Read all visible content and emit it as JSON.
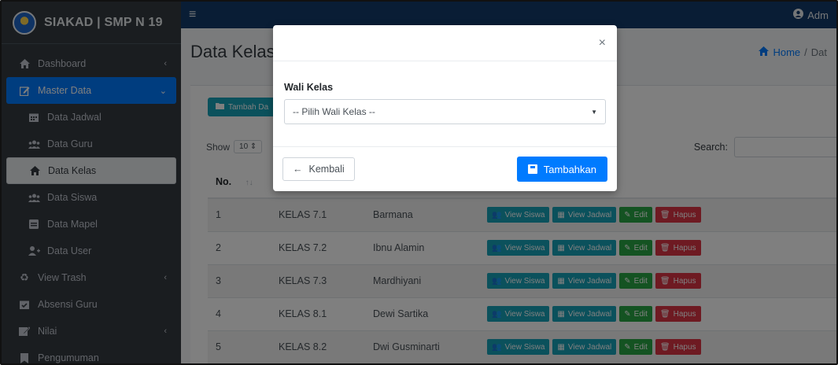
{
  "brand": {
    "title": "SIAKAD | SMP N 19"
  },
  "topbar": {
    "user": "Adm"
  },
  "sidebar": {
    "items": [
      {
        "label": "Dashboard",
        "icon": "home-icon"
      },
      {
        "label": "Master Data",
        "icon": "edit-icon"
      },
      {
        "label": "Data Jadwal",
        "icon": "calendar-icon"
      },
      {
        "label": "Data Guru",
        "icon": "users-icon"
      },
      {
        "label": "Data Kelas",
        "icon": "home-icon"
      },
      {
        "label": "Data Siswa",
        "icon": "users-icon"
      },
      {
        "label": "Data Mapel",
        "icon": "book-icon"
      },
      {
        "label": "Data User",
        "icon": "user-plus-icon"
      },
      {
        "label": "View Trash",
        "icon": "recycle-icon"
      },
      {
        "label": "Absensi Guru",
        "icon": "calendar-check-icon"
      },
      {
        "label": "Nilai",
        "icon": "clipboard-icon"
      },
      {
        "label": "Pengumuman",
        "icon": "bookmark-icon"
      }
    ]
  },
  "page": {
    "title": "Data Kelas",
    "breadcrumb_home": "Home",
    "breadcrumb_current": "Dat"
  },
  "toolbar": {
    "add_label": "Tambah Da",
    "show_label": "Show",
    "show_value": "10",
    "search_label": "Search:"
  },
  "table": {
    "headers": {
      "no": "No."
    },
    "rows": [
      {
        "no": "1",
        "kelas": "KELAS 7.1",
        "wali": "Barmana"
      },
      {
        "no": "2",
        "kelas": "KELAS 7.2",
        "wali": "Ibnu Alamin"
      },
      {
        "no": "3",
        "kelas": "KELAS 7.3",
        "wali": "Mardhiyani"
      },
      {
        "no": "4",
        "kelas": "KELAS 8.1",
        "wali": "Dewi Sartika"
      },
      {
        "no": "5",
        "kelas": "KELAS 8.2",
        "wali": "Dwi Gusminarti"
      }
    ],
    "actions": {
      "view_siswa": "View Siswa",
      "view_jadwal": "View Jadwal",
      "edit": "Edit",
      "hapus": "Hapus"
    }
  },
  "modal": {
    "close_symbol": "×",
    "field_label": "Wali Kelas",
    "select_value": "-- Pilih Wali Kelas --",
    "back_label": "Kembali",
    "submit_label": "Tambahkan"
  },
  "colors": {
    "sidebar_bg": "#343a40",
    "topbar_bg": "#123a6b",
    "primary": "#007bff",
    "teal": "#17a2b8",
    "green": "#28a745",
    "red": "#dc3545"
  }
}
